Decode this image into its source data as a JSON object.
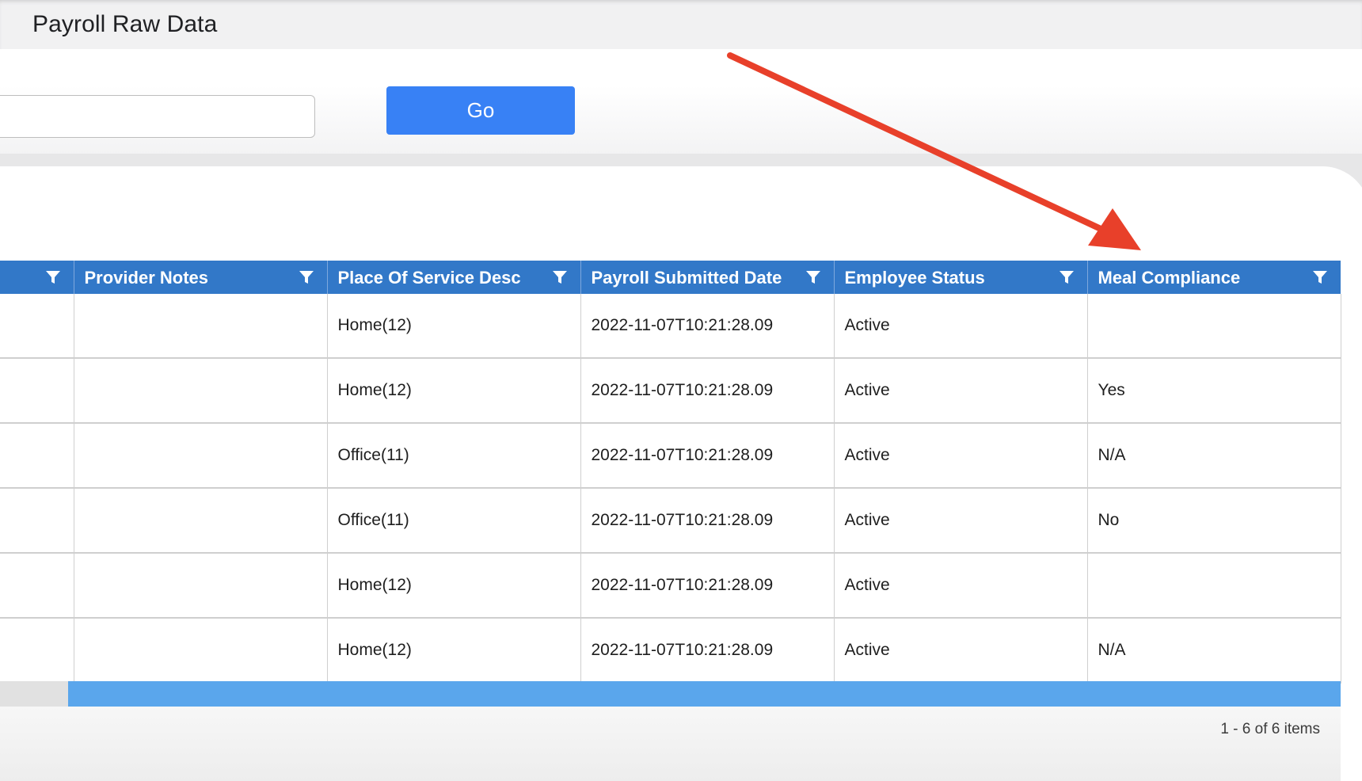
{
  "page": {
    "title": "Payroll Raw Data"
  },
  "search": {
    "value": "",
    "placeholder": ""
  },
  "go_button": {
    "label": "Go"
  },
  "grid": {
    "columns": [
      {
        "label": ""
      },
      {
        "label": "Provider Notes"
      },
      {
        "label": "Place Of Service Desc"
      },
      {
        "label": "Payroll Submitted Date"
      },
      {
        "label": "Employee Status"
      },
      {
        "label": "Meal Compliance"
      }
    ],
    "rows": [
      {
        "cells": [
          "",
          "",
          "Home(12)",
          "2022-11-07T10:21:28.09",
          "Active",
          ""
        ]
      },
      {
        "cells": [
          "",
          "",
          "Home(12)",
          "2022-11-07T10:21:28.09",
          "Active",
          "Yes"
        ]
      },
      {
        "cells": [
          "",
          "",
          "Office(11)",
          "2022-11-07T10:21:28.09",
          "Active",
          "N/A"
        ]
      },
      {
        "cells": [
          "",
          "",
          "Office(11)",
          "2022-11-07T10:21:28.09",
          "Active",
          "No"
        ]
      },
      {
        "cells": [
          "",
          "",
          "Home(12)",
          "2022-11-07T10:21:28.09",
          "Active",
          ""
        ]
      },
      {
        "cells": [
          "",
          "",
          "Home(12)",
          "2022-11-07T10:21:28.09",
          "Active",
          "N/A"
        ]
      }
    ]
  },
  "pager": {
    "info": "1 - 6 of 6 items"
  },
  "colors": {
    "header_bg": "#3278c8",
    "go_button": "#3881f5",
    "scroll_thumb": "#5aa6ec",
    "annotation_arrow": "#e8402a"
  },
  "icons": {
    "filter": "filter-funnel-icon",
    "annotation": "red-arrow-annotation"
  }
}
